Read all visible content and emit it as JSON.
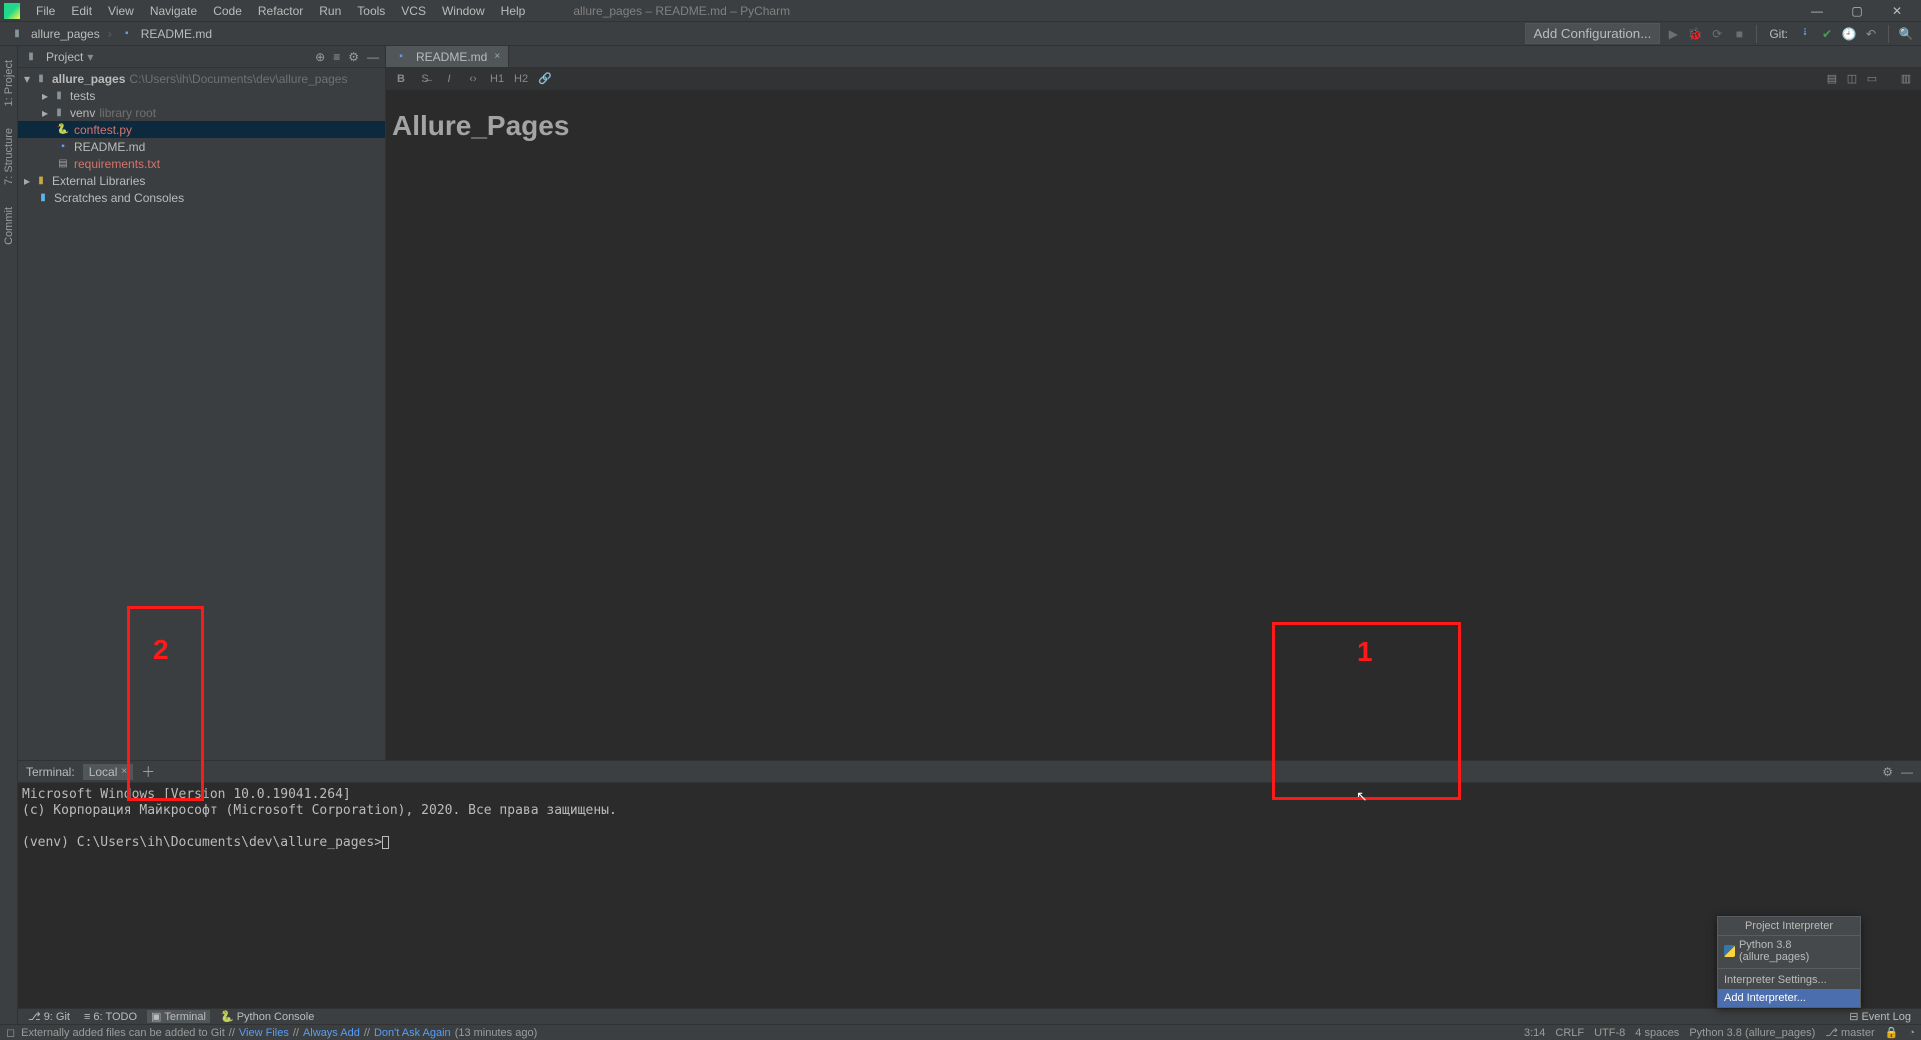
{
  "window": {
    "title": "allure_pages – README.md – PyCharm"
  },
  "menus": [
    "File",
    "Edit",
    "View",
    "Navigate",
    "Code",
    "Refactor",
    "Run",
    "Tools",
    "VCS",
    "Window",
    "Help"
  ],
  "breadcrumb": {
    "root": "allure_pages",
    "file": "README.md"
  },
  "navbar": {
    "add_config": "Add Configuration...",
    "git_label": "Git:"
  },
  "left_gutter": {
    "project": "1: Project",
    "structure": "7: Structure",
    "commit": "Commit"
  },
  "project_panel": {
    "title": "Project",
    "path_root": "allure_pages",
    "path_full": "C:\\Users\\ih\\Documents\\dev\\allure_pages",
    "tests_folder": "tests",
    "venv_folder": "venv",
    "venv_note": "library root",
    "conftest": "conftest.py",
    "readme": "README.md",
    "requirements": "requirements.txt",
    "external_libs": "External Libraries",
    "scratches": "Scratches and Consoles"
  },
  "editor": {
    "tab_label": "README.md",
    "heading": "Allure_Pages",
    "toolbar_h1": "H1",
    "toolbar_h2": "H2"
  },
  "terminal": {
    "header_label": "Terminal:",
    "tab_local": "Local",
    "line1": "Microsoft Windows [Version 10.0.19041.264]",
    "line2": "(c) Корпорация Майкрософт (Microsoft Corporation), 2020. Все права защищены.",
    "prompt": "(venv) C:\\Users\\ih\\Documents\\dev\\allure_pages>"
  },
  "bottom_tools": {
    "git": "9: Git",
    "todo": "6: TODO",
    "terminal": "Terminal",
    "python_console": "Python Console",
    "event_log": "Event Log"
  },
  "statusbar": {
    "message": "Externally added files can be added to Git",
    "link_view": "View Files",
    "link_add": "Always Add",
    "link_dont": "Don't Ask Again",
    "time_ago": "(13 minutes ago)",
    "cursor_pos": "3:14",
    "line_ending": "CRLF",
    "encoding": "UTF-8",
    "indent": "4 spaces",
    "interpreter": "Python 3.8 (allure_pages)",
    "branch": "master"
  },
  "popup": {
    "title": "Project Interpreter",
    "current": "Python 3.8 (allure_pages)",
    "settings": "Interpreter Settings...",
    "add": "Add Interpreter..."
  },
  "annotations": {
    "label1": "1",
    "label2": "2"
  }
}
